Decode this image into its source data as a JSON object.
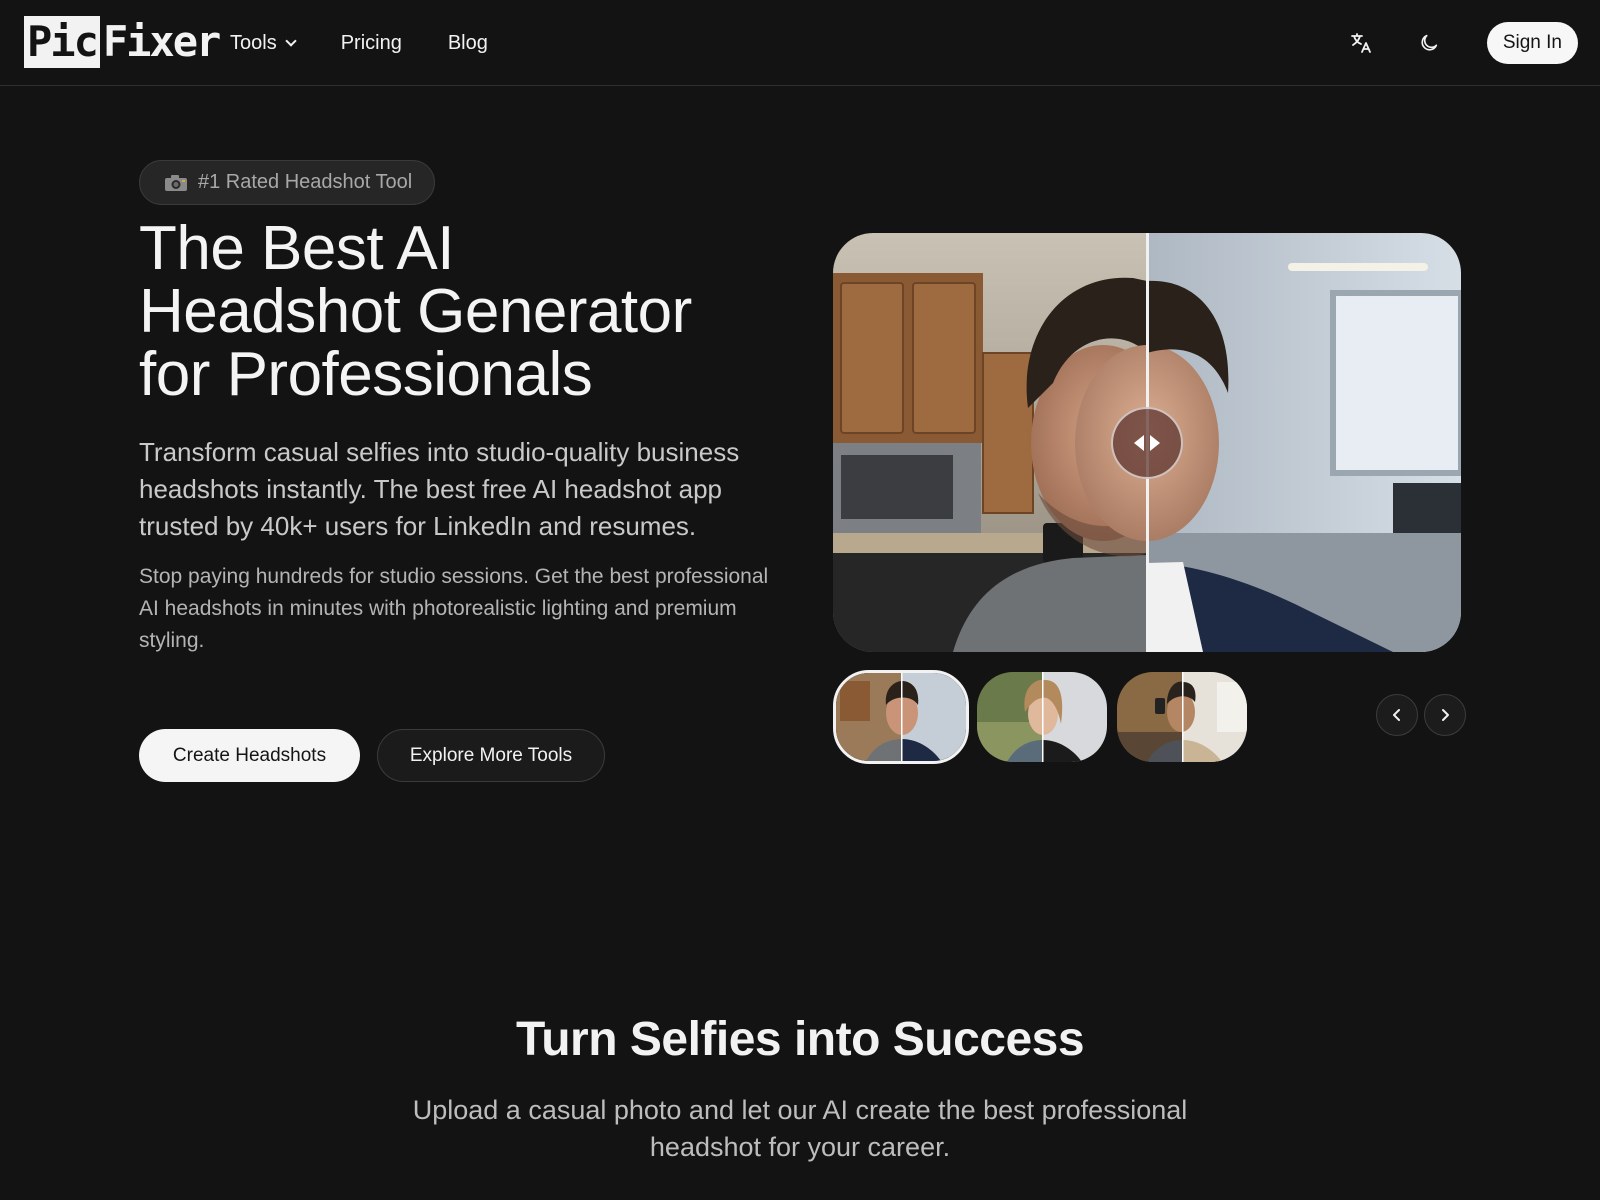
{
  "nav": {
    "logo_part1": "Pic",
    "logo_part2": "Fixer",
    "links": [
      "Tools",
      "Pricing",
      "Blog"
    ],
    "signin_label": "Sign In",
    "icons": [
      "translate-icon",
      "moon-icon"
    ]
  },
  "hero": {
    "badge": "#1 Rated Headshot Tool",
    "title_lines": [
      "The Best AI",
      "Headshot Generator",
      "for Professionals"
    ],
    "description": "Transform casual selfies into studio-quality business headshots instantly. The best free AI headshot app trusted by 40k+ users for LinkedIn and resumes.",
    "subtext": "Stop paying hundreds for studio sessions. Get the best professional AI headshots in minutes with photorealistic lighting and premium styling.",
    "primary_cta": "Create Headshots",
    "secondary_cta": "Explore More Tools"
  },
  "section": {
    "title": "Turn Selfies into Success",
    "description": "Upload a casual photo and let our AI create the best professional headshot for your career."
  },
  "colors": {
    "background": "#131313",
    "text": "#f2f2f2",
    "button_light": "#f5f5f5"
  }
}
